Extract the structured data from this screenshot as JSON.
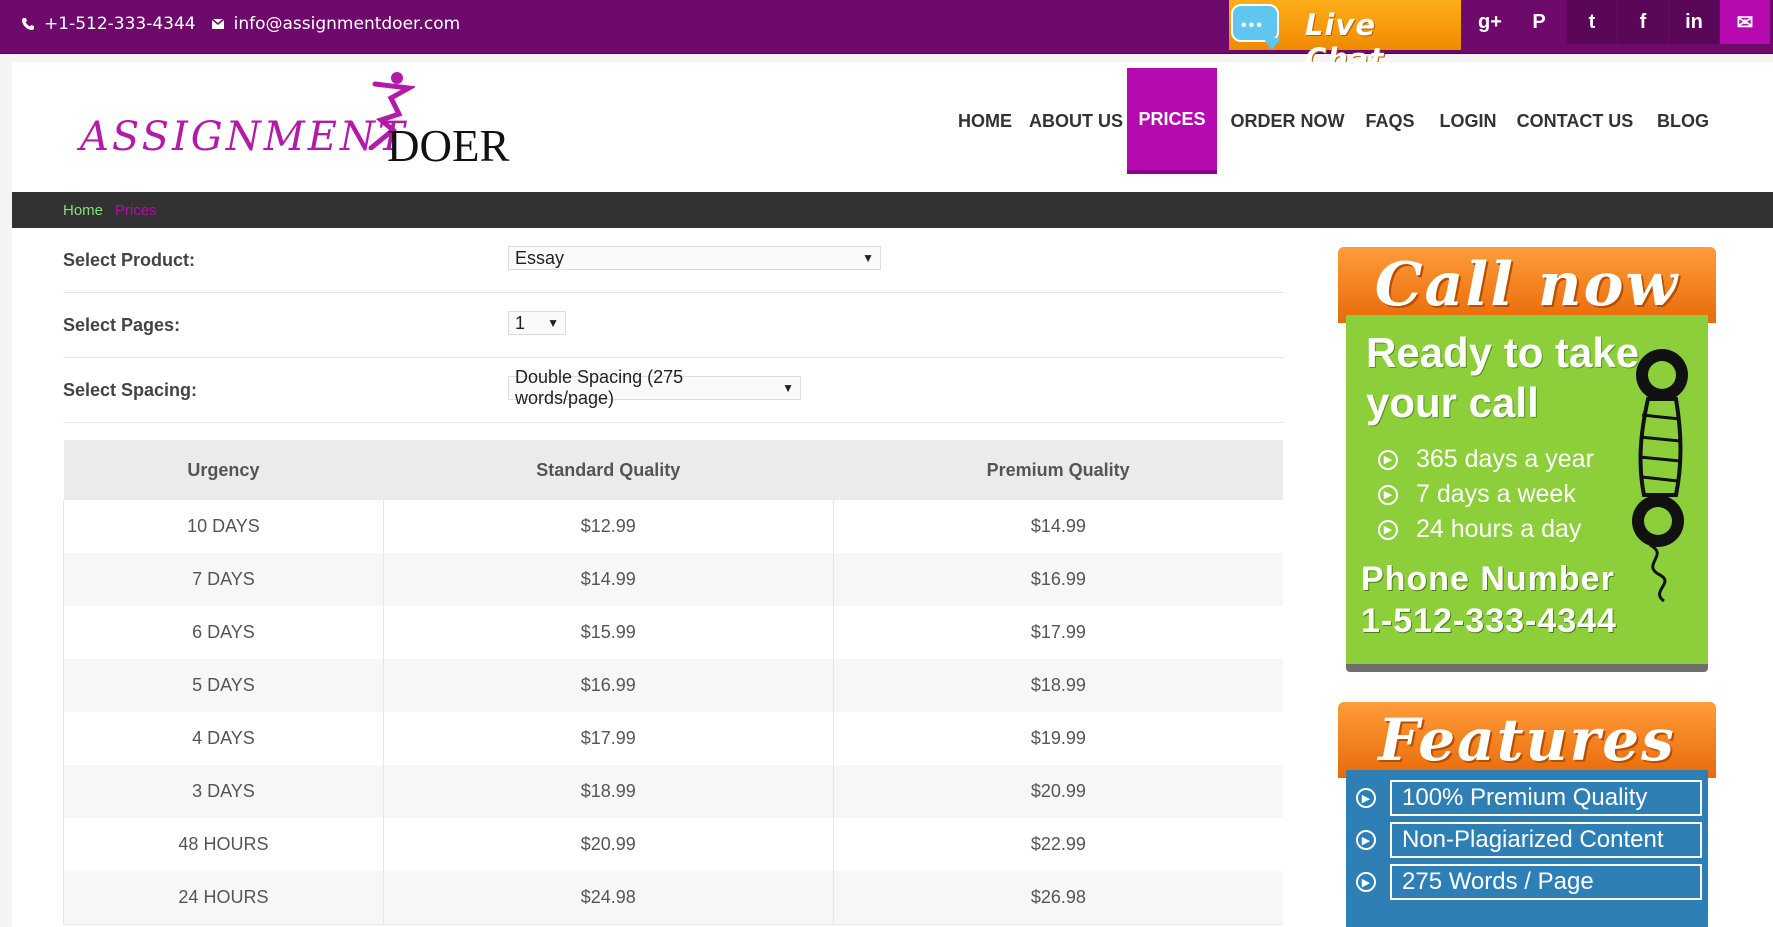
{
  "topbar": {
    "phone": "+1-512-333-4344",
    "email": "info@assignmentdoer.com",
    "live_chat": "Live Chat",
    "social": [
      {
        "name": "google-plus",
        "glyph": "g+"
      },
      {
        "name": "pinterest",
        "glyph": "P"
      },
      {
        "name": "tumblr",
        "glyph": "t"
      },
      {
        "name": "facebook",
        "glyph": "f"
      },
      {
        "name": "linkedin",
        "glyph": "in"
      },
      {
        "name": "mail",
        "glyph": "✉"
      }
    ]
  },
  "logo": {
    "part1": "ASSIGNMENT",
    "part2": "DOER"
  },
  "nav": [
    {
      "label": "HOME"
    },
    {
      "label": "ABOUT US"
    },
    {
      "label": "PRICES",
      "active": true
    },
    {
      "label": "ORDER NOW"
    },
    {
      "label": "FAQS"
    },
    {
      "label": "LOGIN"
    },
    {
      "label": "CONTACT US"
    },
    {
      "label": "BLOG"
    }
  ],
  "breadcrumb": {
    "home": "Home",
    "current": "Prices"
  },
  "form": {
    "product": {
      "label": "Select Product:",
      "value": "Essay"
    },
    "pages": {
      "label": "Select Pages:",
      "value": "1"
    },
    "spacing": {
      "label": "Select Spacing:",
      "value": "Double Spacing (275 words/page)"
    }
  },
  "pricing": {
    "headers": [
      "Urgency",
      "Standard Quality",
      "Premium Quality"
    ],
    "rows": [
      [
        "10 DAYS",
        "$12.99",
        "$14.99"
      ],
      [
        "7 DAYS",
        "$14.99",
        "$16.99"
      ],
      [
        "6 DAYS",
        "$15.99",
        "$17.99"
      ],
      [
        "5 DAYS",
        "$16.99",
        "$18.99"
      ],
      [
        "4 DAYS",
        "$17.99",
        "$19.99"
      ],
      [
        "3 DAYS",
        "$18.99",
        "$20.99"
      ],
      [
        "48 HOURS",
        "$20.99",
        "$22.99"
      ],
      [
        "24 HOURS",
        "$24.98",
        "$26.98"
      ]
    ]
  },
  "callbox": {
    "title": "Call now",
    "line1": "Ready to take",
    "line2": "your call",
    "bullets": [
      "365 days a year",
      "7 days a week",
      "24 hours a day"
    ],
    "phone_label": "Phone Number",
    "phone": "1-512-333-4344"
  },
  "features": {
    "title": "Features",
    "items": [
      "100% Premium Quality",
      "Non-Plagiarized Content",
      "275 Words / Page"
    ]
  },
  "colors": {
    "brand_purple": "#6d0a6b",
    "accent_magenta": "#b40ab0",
    "call_green": "#8ccf3a",
    "features_blue": "#2f7fb7",
    "header_orange": "#f08a00"
  }
}
